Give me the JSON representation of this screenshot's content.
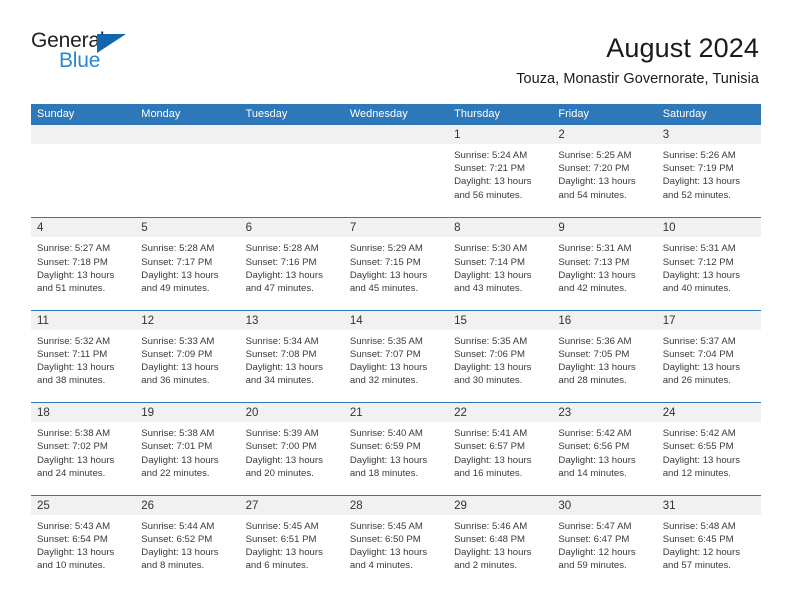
{
  "logo": {
    "word1": "General",
    "word2": "Blue",
    "triangle_color": "#1266ad",
    "word2_color": "#2a87d0"
  },
  "header": {
    "month_year": "August 2024",
    "location": "Touza, Monastir Governorate, Tunisia"
  },
  "theme": {
    "header_blue": "#2e78b9",
    "date_band_gray": "#f1f1f1",
    "text_color": "#3a3a3a"
  },
  "weekdays": [
    "Sunday",
    "Monday",
    "Tuesday",
    "Wednesday",
    "Thursday",
    "Friday",
    "Saturday"
  ],
  "weeks": [
    [
      {
        "day": "",
        "lines": []
      },
      {
        "day": "",
        "lines": []
      },
      {
        "day": "",
        "lines": []
      },
      {
        "day": "",
        "lines": []
      },
      {
        "day": "1",
        "lines": [
          "Sunrise: 5:24 AM",
          "Sunset: 7:21 PM",
          "Daylight: 13 hours",
          "and 56 minutes."
        ]
      },
      {
        "day": "2",
        "lines": [
          "Sunrise: 5:25 AM",
          "Sunset: 7:20 PM",
          "Daylight: 13 hours",
          "and 54 minutes."
        ]
      },
      {
        "day": "3",
        "lines": [
          "Sunrise: 5:26 AM",
          "Sunset: 7:19 PM",
          "Daylight: 13 hours",
          "and 52 minutes."
        ]
      }
    ],
    [
      {
        "day": "4",
        "lines": [
          "Sunrise: 5:27 AM",
          "Sunset: 7:18 PM",
          "Daylight: 13 hours",
          "and 51 minutes."
        ]
      },
      {
        "day": "5",
        "lines": [
          "Sunrise: 5:28 AM",
          "Sunset: 7:17 PM",
          "Daylight: 13 hours",
          "and 49 minutes."
        ]
      },
      {
        "day": "6",
        "lines": [
          "Sunrise: 5:28 AM",
          "Sunset: 7:16 PM",
          "Daylight: 13 hours",
          "and 47 minutes."
        ]
      },
      {
        "day": "7",
        "lines": [
          "Sunrise: 5:29 AM",
          "Sunset: 7:15 PM",
          "Daylight: 13 hours",
          "and 45 minutes."
        ]
      },
      {
        "day": "8",
        "lines": [
          "Sunrise: 5:30 AM",
          "Sunset: 7:14 PM",
          "Daylight: 13 hours",
          "and 43 minutes."
        ]
      },
      {
        "day": "9",
        "lines": [
          "Sunrise: 5:31 AM",
          "Sunset: 7:13 PM",
          "Daylight: 13 hours",
          "and 42 minutes."
        ]
      },
      {
        "day": "10",
        "lines": [
          "Sunrise: 5:31 AM",
          "Sunset: 7:12 PM",
          "Daylight: 13 hours",
          "and 40 minutes."
        ]
      }
    ],
    [
      {
        "day": "11",
        "lines": [
          "Sunrise: 5:32 AM",
          "Sunset: 7:11 PM",
          "Daylight: 13 hours",
          "and 38 minutes."
        ]
      },
      {
        "day": "12",
        "lines": [
          "Sunrise: 5:33 AM",
          "Sunset: 7:09 PM",
          "Daylight: 13 hours",
          "and 36 minutes."
        ]
      },
      {
        "day": "13",
        "lines": [
          "Sunrise: 5:34 AM",
          "Sunset: 7:08 PM",
          "Daylight: 13 hours",
          "and 34 minutes."
        ]
      },
      {
        "day": "14",
        "lines": [
          "Sunrise: 5:35 AM",
          "Sunset: 7:07 PM",
          "Daylight: 13 hours",
          "and 32 minutes."
        ]
      },
      {
        "day": "15",
        "lines": [
          "Sunrise: 5:35 AM",
          "Sunset: 7:06 PM",
          "Daylight: 13 hours",
          "and 30 minutes."
        ]
      },
      {
        "day": "16",
        "lines": [
          "Sunrise: 5:36 AM",
          "Sunset: 7:05 PM",
          "Daylight: 13 hours",
          "and 28 minutes."
        ]
      },
      {
        "day": "17",
        "lines": [
          "Sunrise: 5:37 AM",
          "Sunset: 7:04 PM",
          "Daylight: 13 hours",
          "and 26 minutes."
        ]
      }
    ],
    [
      {
        "day": "18",
        "lines": [
          "Sunrise: 5:38 AM",
          "Sunset: 7:02 PM",
          "Daylight: 13 hours",
          "and 24 minutes."
        ]
      },
      {
        "day": "19",
        "lines": [
          "Sunrise: 5:38 AM",
          "Sunset: 7:01 PM",
          "Daylight: 13 hours",
          "and 22 minutes."
        ]
      },
      {
        "day": "20",
        "lines": [
          "Sunrise: 5:39 AM",
          "Sunset: 7:00 PM",
          "Daylight: 13 hours",
          "and 20 minutes."
        ]
      },
      {
        "day": "21",
        "lines": [
          "Sunrise: 5:40 AM",
          "Sunset: 6:59 PM",
          "Daylight: 13 hours",
          "and 18 minutes."
        ]
      },
      {
        "day": "22",
        "lines": [
          "Sunrise: 5:41 AM",
          "Sunset: 6:57 PM",
          "Daylight: 13 hours",
          "and 16 minutes."
        ]
      },
      {
        "day": "23",
        "lines": [
          "Sunrise: 5:42 AM",
          "Sunset: 6:56 PM",
          "Daylight: 13 hours",
          "and 14 minutes."
        ]
      },
      {
        "day": "24",
        "lines": [
          "Sunrise: 5:42 AM",
          "Sunset: 6:55 PM",
          "Daylight: 13 hours",
          "and 12 minutes."
        ]
      }
    ],
    [
      {
        "day": "25",
        "lines": [
          "Sunrise: 5:43 AM",
          "Sunset: 6:54 PM",
          "Daylight: 13 hours",
          "and 10 minutes."
        ]
      },
      {
        "day": "26",
        "lines": [
          "Sunrise: 5:44 AM",
          "Sunset: 6:52 PM",
          "Daylight: 13 hours",
          "and 8 minutes."
        ]
      },
      {
        "day": "27",
        "lines": [
          "Sunrise: 5:45 AM",
          "Sunset: 6:51 PM",
          "Daylight: 13 hours",
          "and 6 minutes."
        ]
      },
      {
        "day": "28",
        "lines": [
          "Sunrise: 5:45 AM",
          "Sunset: 6:50 PM",
          "Daylight: 13 hours",
          "and 4 minutes."
        ]
      },
      {
        "day": "29",
        "lines": [
          "Sunrise: 5:46 AM",
          "Sunset: 6:48 PM",
          "Daylight: 13 hours",
          "and 2 minutes."
        ]
      },
      {
        "day": "30",
        "lines": [
          "Sunrise: 5:47 AM",
          "Sunset: 6:47 PM",
          "Daylight: 12 hours",
          "and 59 minutes."
        ]
      },
      {
        "day": "31",
        "lines": [
          "Sunrise: 5:48 AM",
          "Sunset: 6:45 PM",
          "Daylight: 12 hours",
          "and 57 minutes."
        ]
      }
    ]
  ]
}
